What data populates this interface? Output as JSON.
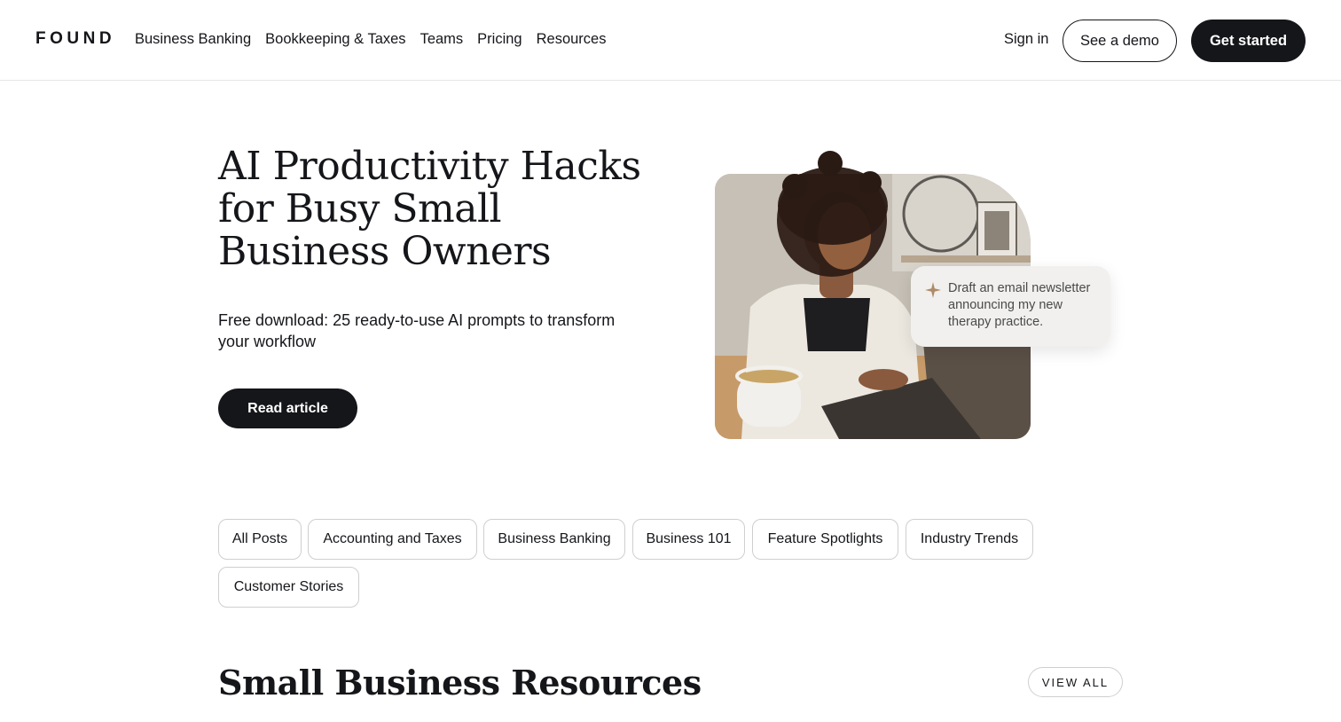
{
  "header": {
    "logo": "FOUND",
    "nav": [
      "Business Banking",
      "Bookkeeping & Taxes",
      "Teams",
      "Pricing",
      "Resources"
    ],
    "sign_in": "Sign in",
    "demo_label": "See a demo",
    "start_label": "Get started"
  },
  "hero": {
    "title": "AI Productivity Hacks for Busy Small Business Owners",
    "subtitle": "Free download: 25 ready-to-use AI prompts to transform your workflow",
    "cta_label": "Read article",
    "ai_prompt": "Draft an email newsletter announcing my new therapy practice."
  },
  "filters": [
    "All Posts",
    "Accounting and Taxes",
    "Business Banking",
    "Business 101",
    "Feature Spotlights",
    "Industry Trends",
    "Customer Stories"
  ],
  "section": {
    "title": "Small Business Resources",
    "view_all_label": "VIEW ALL"
  },
  "colors": {
    "primary": "#15161a",
    "background": "#ffffff",
    "card": "#f1f0ee",
    "sparkle": "#b08a66"
  }
}
